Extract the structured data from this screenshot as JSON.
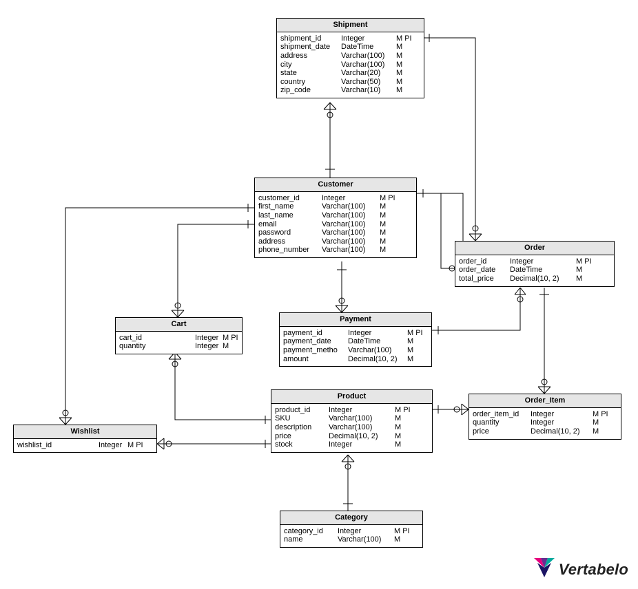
{
  "brand": {
    "name": "Vertabelo"
  },
  "entities": {
    "shipment": {
      "title": "Shipment",
      "cols": [
        {
          "name": "shipment_id",
          "type": "Integer",
          "flags": "M PI"
        },
        {
          "name": "shipment_date",
          "type": "DateTime",
          "flags": "M"
        },
        {
          "name": "address",
          "type": "Varchar(100)",
          "flags": "M"
        },
        {
          "name": "city",
          "type": "Varchar(100)",
          "flags": "M"
        },
        {
          "name": "state",
          "type": "Varchar(20)",
          "flags": "M"
        },
        {
          "name": "country",
          "type": "Varchar(50)",
          "flags": "M"
        },
        {
          "name": "zip_code",
          "type": "Varchar(10)",
          "flags": "M"
        }
      ]
    },
    "customer": {
      "title": "Customer",
      "cols": [
        {
          "name": "customer_id",
          "type": "Integer",
          "flags": "M PI"
        },
        {
          "name": "first_name",
          "type": "Varchar(100)",
          "flags": "M"
        },
        {
          "name": "last_name",
          "type": "Varchar(100)",
          "flags": "M"
        },
        {
          "name": "email",
          "type": "Varchar(100)",
          "flags": "M"
        },
        {
          "name": "password",
          "type": "Varchar(100)",
          "flags": "M"
        },
        {
          "name": "address",
          "type": "Varchar(100)",
          "flags": "M"
        },
        {
          "name": "phone_number",
          "type": "Varchar(100)",
          "flags": "M"
        }
      ]
    },
    "order": {
      "title": "Order",
      "cols": [
        {
          "name": "order_id",
          "type": "Integer",
          "flags": "M PI"
        },
        {
          "name": "order_date",
          "type": "DateTime",
          "flags": "M"
        },
        {
          "name": "total_price",
          "type": "Decimal(10, 2)",
          "flags": "M"
        }
      ]
    },
    "cart": {
      "title": "Cart",
      "cols": [
        {
          "name": "cart_id",
          "type": "Integer",
          "flags": "M PI"
        },
        {
          "name": "quantity",
          "type": "Integer",
          "flags": "M"
        }
      ]
    },
    "payment": {
      "title": "Payment",
      "cols": [
        {
          "name": "payment_id",
          "type": "Integer",
          "flags": "M PI"
        },
        {
          "name": "payment_date",
          "type": "DateTime",
          "flags": "M"
        },
        {
          "name": "payment_metho",
          "type": "Varchar(100)",
          "flags": "M"
        },
        {
          "name": "amount",
          "type": "Decimal(10, 2)",
          "flags": "M"
        }
      ]
    },
    "product": {
      "title": "Product",
      "cols": [
        {
          "name": "product_id",
          "type": "Integer",
          "flags": "M PI"
        },
        {
          "name": "SKU",
          "type": "Varchar(100)",
          "flags": "M"
        },
        {
          "name": "description",
          "type": "Varchar(100)",
          "flags": "M"
        },
        {
          "name": "price",
          "type": "Decimal(10, 2)",
          "flags": "M"
        },
        {
          "name": "stock",
          "type": "Integer",
          "flags": "M"
        }
      ]
    },
    "order_item": {
      "title": "Order_Item",
      "cols": [
        {
          "name": "order_item_id",
          "type": "Integer",
          "flags": "M PI"
        },
        {
          "name": "quantity",
          "type": "Integer",
          "flags": "M"
        },
        {
          "name": "price",
          "type": "Decimal(10, 2)",
          "flags": "M"
        }
      ]
    },
    "wishlist": {
      "title": "Wishlist",
      "cols": [
        {
          "name": "wishlist_id",
          "type": "Integer",
          "flags": "M PI"
        }
      ]
    },
    "category": {
      "title": "Category",
      "cols": [
        {
          "name": "category_id",
          "type": "Integer",
          "flags": "M PI"
        },
        {
          "name": "name",
          "type": "Varchar(100)",
          "flags": "M"
        }
      ]
    }
  },
  "relationships": [
    {
      "from": "Customer",
      "to": "Shipment",
      "cardinality": "one-to-many"
    },
    {
      "from": "Customer",
      "to": "Order",
      "cardinality": "one-to-many"
    },
    {
      "from": "Customer",
      "to": "Payment",
      "cardinality": "one-to-many"
    },
    {
      "from": "Customer",
      "to": "Cart",
      "cardinality": "one-to-many"
    },
    {
      "from": "Customer",
      "to": "Wishlist",
      "cardinality": "one-to-many"
    },
    {
      "from": "Order",
      "to": "Shipment",
      "cardinality": "one-to-one"
    },
    {
      "from": "Order",
      "to": "Payment",
      "cardinality": "one-to-one"
    },
    {
      "from": "Order",
      "to": "Order_Item",
      "cardinality": "one-to-many"
    },
    {
      "from": "Product",
      "to": "Order_Item",
      "cardinality": "one-to-many"
    },
    {
      "from": "Product",
      "to": "Cart",
      "cardinality": "one-to-many"
    },
    {
      "from": "Product",
      "to": "Wishlist",
      "cardinality": "one-to-many"
    },
    {
      "from": "Category",
      "to": "Product",
      "cardinality": "one-to-many"
    }
  ]
}
